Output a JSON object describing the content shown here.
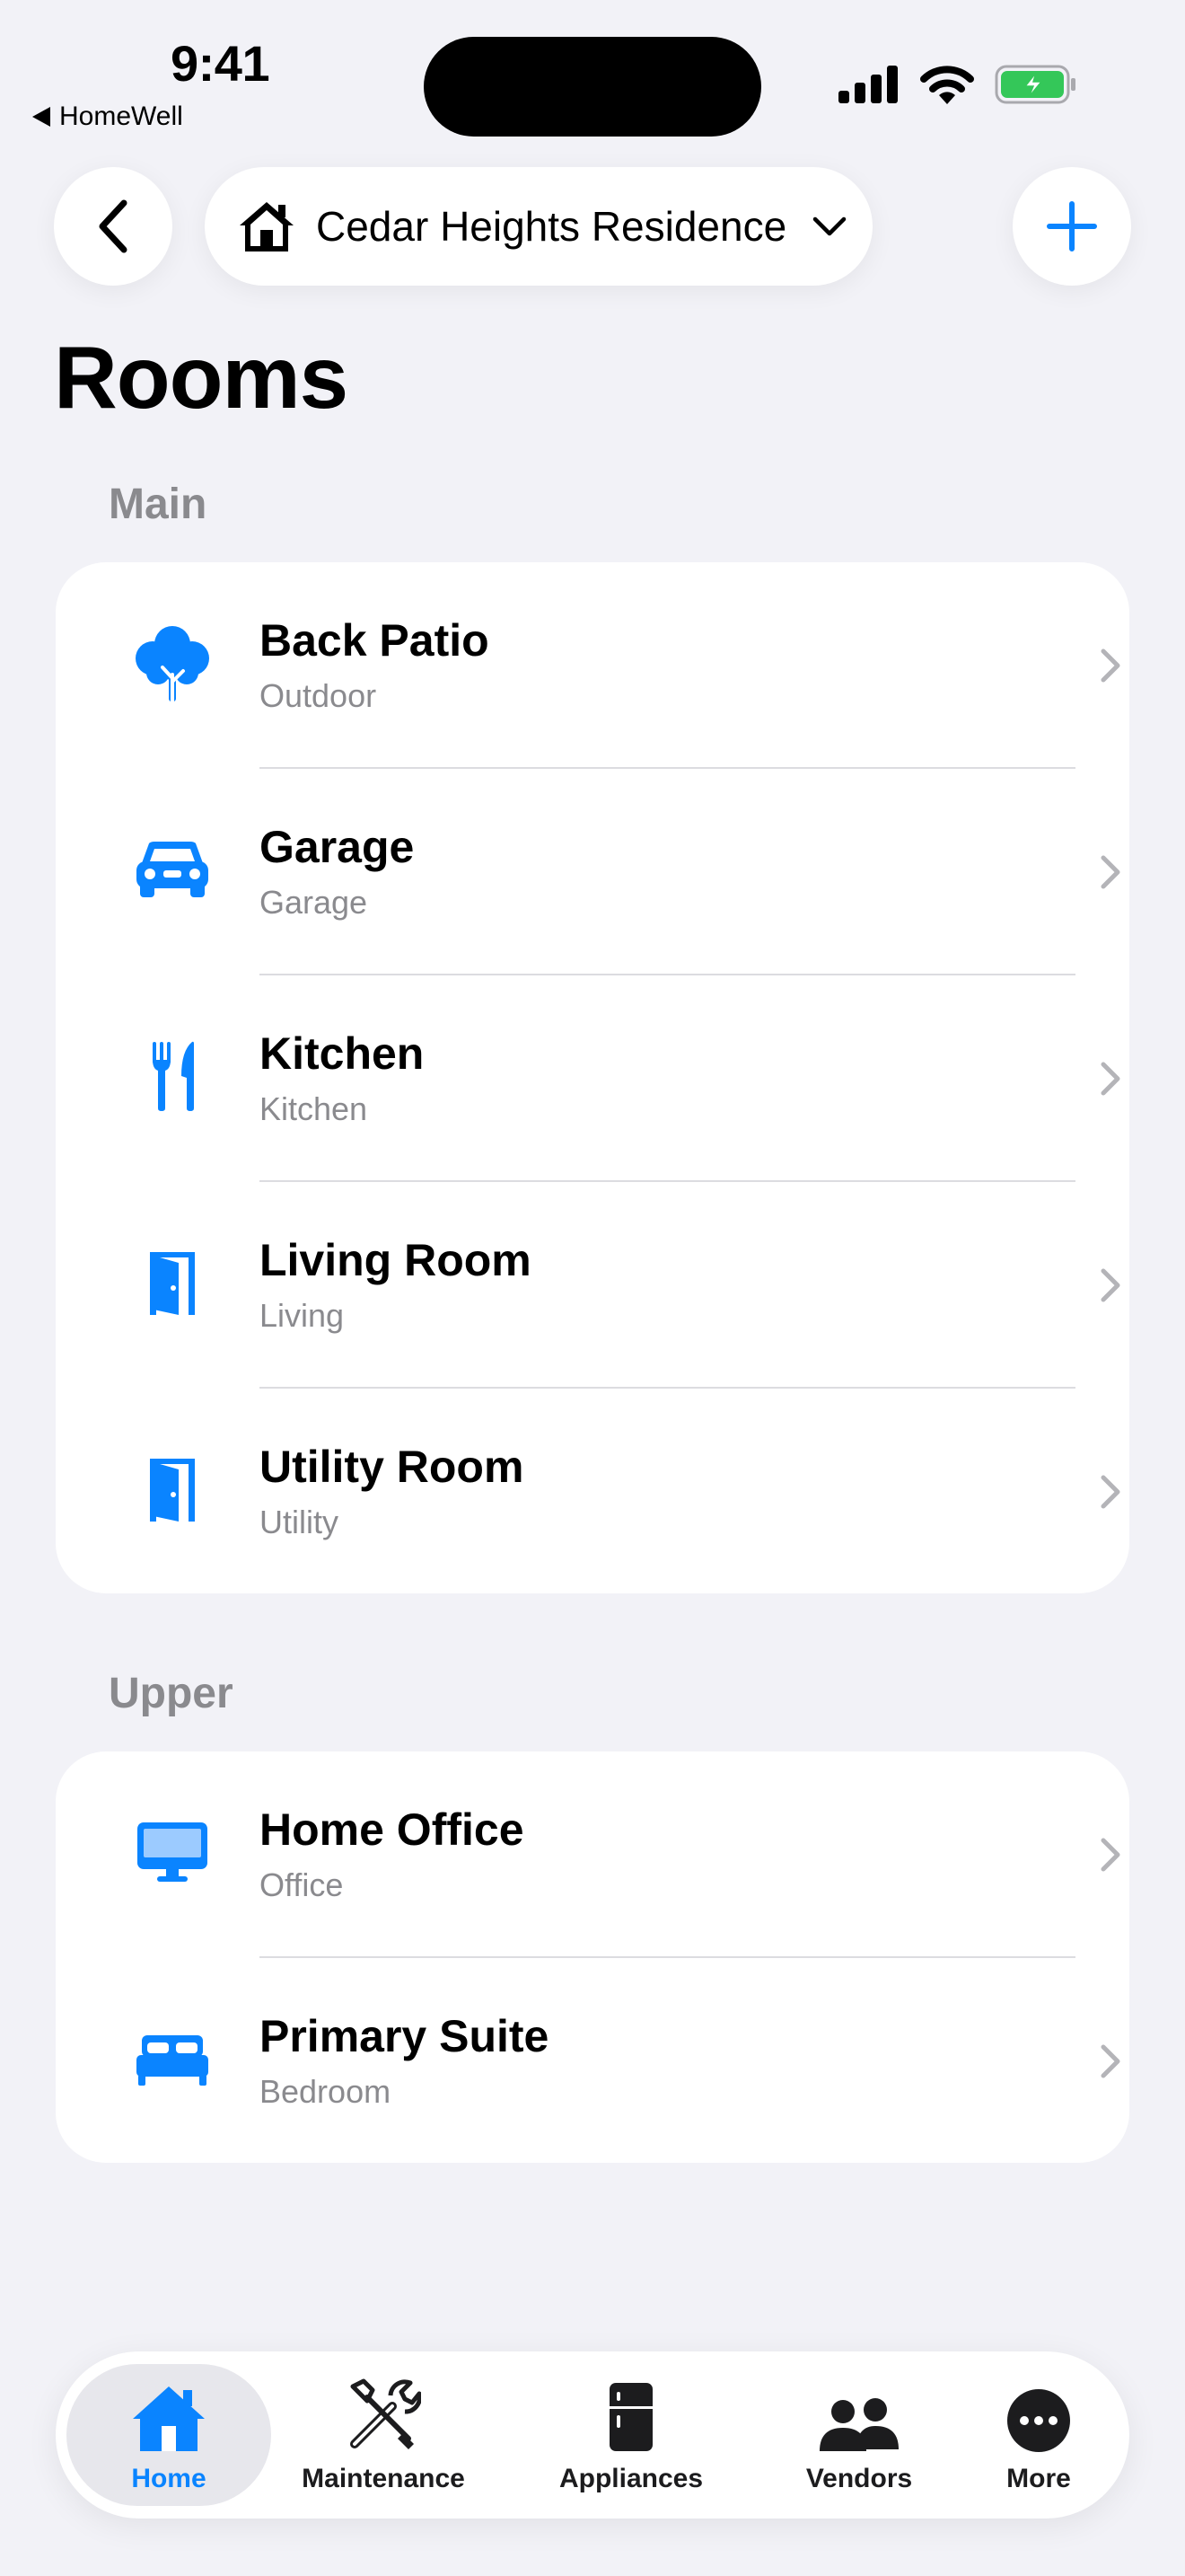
{
  "status_bar": {
    "time": "9:41",
    "back_app": "HomeWell"
  },
  "nav": {
    "home_name": "Cedar Heights Residence",
    "icons": [
      "chevron-left-icon",
      "house-icon",
      "chevron-down-icon",
      "plus-icon"
    ]
  },
  "page": {
    "title": "Rooms"
  },
  "accent_color": "#0A84FF",
  "sections": [
    {
      "label": "Main",
      "rooms": [
        {
          "name": "Back Patio",
          "type": "Outdoor",
          "icon": "tree-icon"
        },
        {
          "name": "Garage",
          "type": "Garage",
          "icon": "car-icon"
        },
        {
          "name": "Kitchen",
          "type": "Kitchen",
          "icon": "fork-knife-icon"
        },
        {
          "name": "Living Room",
          "type": "Living",
          "icon": "door-icon"
        },
        {
          "name": "Utility Room",
          "type": "Utility",
          "icon": "door-icon"
        }
      ]
    },
    {
      "label": "Upper",
      "rooms": [
        {
          "name": "Home Office",
          "type": "Office",
          "icon": "desktop-icon"
        },
        {
          "name": "Primary Suite",
          "type": "Bedroom",
          "icon": "bed-icon"
        }
      ]
    }
  ],
  "tabbar": {
    "active": "Home",
    "tabs": [
      {
        "label": "Home",
        "icon": "house-icon"
      },
      {
        "label": "Maintenance",
        "icon": "tools-icon"
      },
      {
        "label": "Appliances",
        "icon": "refrigerator-icon"
      },
      {
        "label": "Vendors",
        "icon": "people-icon"
      },
      {
        "label": "More",
        "icon": "ellipsis-circle-icon"
      }
    ]
  }
}
